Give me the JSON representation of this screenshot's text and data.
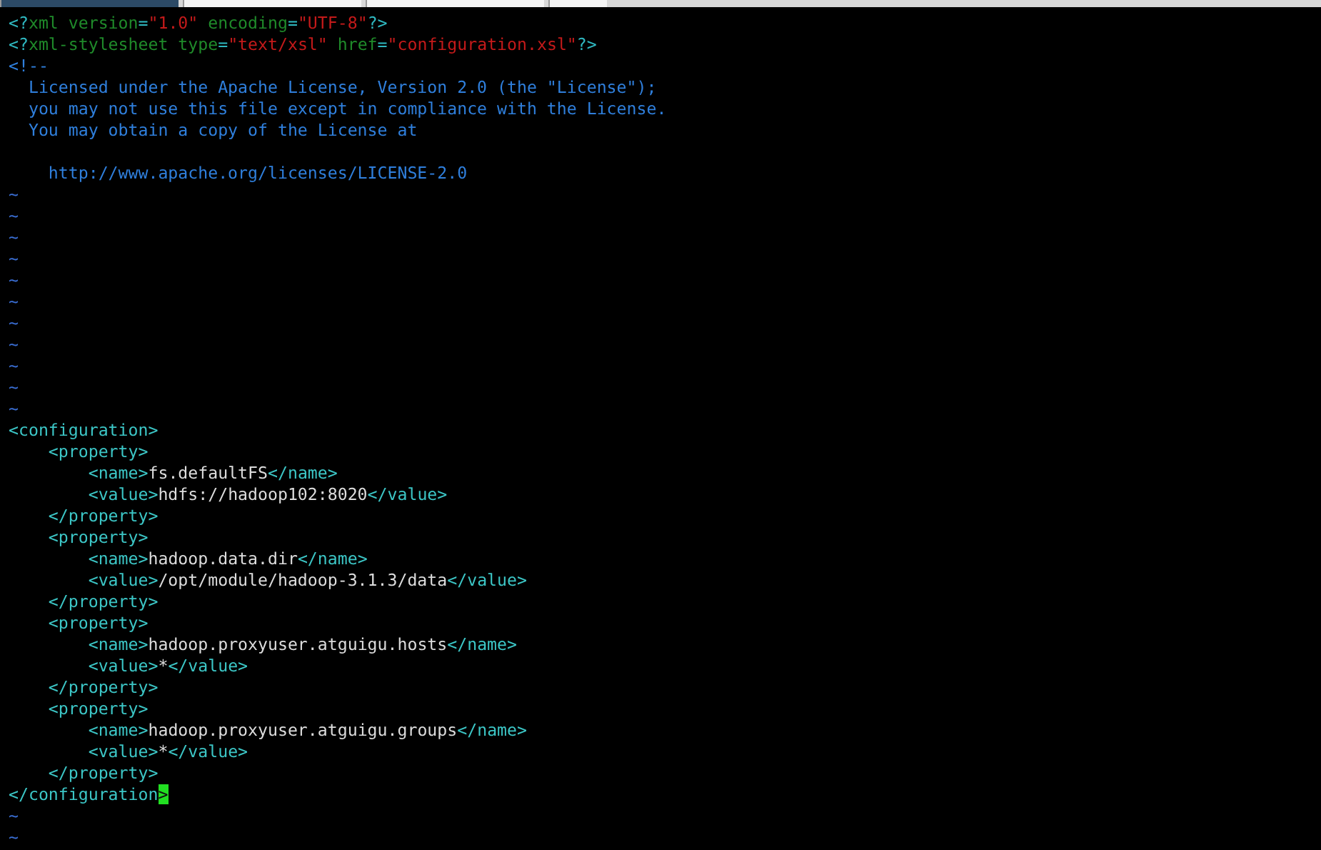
{
  "tabs": [
    {
      "selected": true
    },
    {
      "selected": false
    },
    {
      "selected": false
    },
    {
      "selected": false
    }
  ],
  "lines": [
    {
      "kind": "code",
      "segments": [
        {
          "kind": "punct",
          "text": "<?"
        },
        {
          "kind": "pi",
          "text": "xml version"
        },
        {
          "kind": "punct",
          "text": "="
        },
        {
          "kind": "str",
          "text": "\"1.0\""
        },
        {
          "kind": "pi",
          "text": " encoding"
        },
        {
          "kind": "punct",
          "text": "="
        },
        {
          "kind": "str",
          "text": "\"UTF-8\""
        },
        {
          "kind": "punct",
          "text": "?>"
        }
      ]
    },
    {
      "kind": "code",
      "segments": [
        {
          "kind": "punct",
          "text": "<?"
        },
        {
          "kind": "pi",
          "text": "xml-stylesheet type"
        },
        {
          "kind": "punct",
          "text": "="
        },
        {
          "kind": "str",
          "text": "\"text/xsl\""
        },
        {
          "kind": "pi",
          "text": " href"
        },
        {
          "kind": "punct",
          "text": "="
        },
        {
          "kind": "str",
          "text": "\"configuration.xsl\""
        },
        {
          "kind": "punct",
          "text": "?>"
        }
      ]
    },
    {
      "kind": "code",
      "segments": [
        {
          "kind": "comment",
          "text": "<!--"
        }
      ]
    },
    {
      "kind": "code",
      "segments": [
        {
          "kind": "comment",
          "text": "  Licensed under the Apache License, Version 2.0 (the \"License\");"
        }
      ]
    },
    {
      "kind": "code",
      "segments": [
        {
          "kind": "comment",
          "text": "  you may not use this file except in compliance with the License."
        }
      ]
    },
    {
      "kind": "code",
      "segments": [
        {
          "kind": "comment",
          "text": "  You may obtain a copy of the License at"
        }
      ]
    },
    {
      "kind": "blank"
    },
    {
      "kind": "code",
      "segments": [
        {
          "kind": "comment",
          "text": "    http://www.apache.org/licenses/LICENSE-2.0"
        }
      ]
    },
    {
      "kind": "tilde",
      "text": "~"
    },
    {
      "kind": "tilde",
      "text": "~"
    },
    {
      "kind": "tilde",
      "text": "~"
    },
    {
      "kind": "tilde",
      "text": "~"
    },
    {
      "kind": "tilde",
      "text": "~"
    },
    {
      "kind": "tilde",
      "text": "~"
    },
    {
      "kind": "tilde",
      "text": "~"
    },
    {
      "kind": "tilde",
      "text": "~"
    },
    {
      "kind": "tilde",
      "text": "~"
    },
    {
      "kind": "tilde",
      "text": "~"
    },
    {
      "kind": "tilde",
      "text": "~"
    },
    {
      "kind": "code",
      "segments": [
        {
          "kind": "tag",
          "text": "<configuration>"
        }
      ]
    },
    {
      "kind": "code",
      "segments": [
        {
          "kind": "tag",
          "text": "    <property>"
        }
      ]
    },
    {
      "kind": "code",
      "segments": [
        {
          "kind": "tag",
          "text": "        <name>"
        },
        {
          "kind": "text",
          "text": "fs.defaultFS"
        },
        {
          "kind": "tag",
          "text": "</name>"
        }
      ]
    },
    {
      "kind": "code",
      "segments": [
        {
          "kind": "tag",
          "text": "        <value>"
        },
        {
          "kind": "text",
          "text": "hdfs://hadoop102:8020"
        },
        {
          "kind": "tag",
          "text": "</value>"
        }
      ]
    },
    {
      "kind": "code",
      "segments": [
        {
          "kind": "tag",
          "text": "    </property>"
        }
      ]
    },
    {
      "kind": "code",
      "segments": [
        {
          "kind": "tag",
          "text": "    <property>"
        }
      ]
    },
    {
      "kind": "code",
      "segments": [
        {
          "kind": "tag",
          "text": "        <name>"
        },
        {
          "kind": "text",
          "text": "hadoop.data.dir"
        },
        {
          "kind": "tag",
          "text": "</name>"
        }
      ]
    },
    {
      "kind": "code",
      "segments": [
        {
          "kind": "tag",
          "text": "        <value>"
        },
        {
          "kind": "text",
          "text": "/opt/module/hadoop-3.1.3/data"
        },
        {
          "kind": "tag",
          "text": "</value>"
        }
      ]
    },
    {
      "kind": "code",
      "segments": [
        {
          "kind": "tag",
          "text": "    </property>"
        }
      ]
    },
    {
      "kind": "code",
      "segments": [
        {
          "kind": "tag",
          "text": "    <property>"
        }
      ]
    },
    {
      "kind": "code",
      "segments": [
        {
          "kind": "tag",
          "text": "        <name>"
        },
        {
          "kind": "text",
          "text": "hadoop.proxyuser.atguigu.hosts"
        },
        {
          "kind": "tag",
          "text": "</name>"
        }
      ]
    },
    {
      "kind": "code",
      "segments": [
        {
          "kind": "tag",
          "text": "        <value>"
        },
        {
          "kind": "text",
          "text": "*"
        },
        {
          "kind": "tag",
          "text": "</value>"
        }
      ]
    },
    {
      "kind": "code",
      "segments": [
        {
          "kind": "tag",
          "text": "    </property>"
        }
      ]
    },
    {
      "kind": "code",
      "segments": [
        {
          "kind": "tag",
          "text": "    <property>"
        }
      ]
    },
    {
      "kind": "code",
      "segments": [
        {
          "kind": "tag",
          "text": "        <name>"
        },
        {
          "kind": "text",
          "text": "hadoop.proxyuser.atguigu.groups"
        },
        {
          "kind": "tag",
          "text": "</name>"
        }
      ]
    },
    {
      "kind": "code",
      "segments": [
        {
          "kind": "tag",
          "text": "        <value>"
        },
        {
          "kind": "text",
          "text": "*"
        },
        {
          "kind": "tag",
          "text": "</value>"
        }
      ]
    },
    {
      "kind": "code",
      "segments": [
        {
          "kind": "tag",
          "text": "    </property>"
        }
      ]
    },
    {
      "kind": "code",
      "segments": [
        {
          "kind": "tag",
          "text": "</configuration"
        },
        {
          "kind": "cursor",
          "text": ">"
        }
      ]
    },
    {
      "kind": "tilde",
      "text": "~"
    },
    {
      "kind": "tilde",
      "text": "~"
    }
  ]
}
